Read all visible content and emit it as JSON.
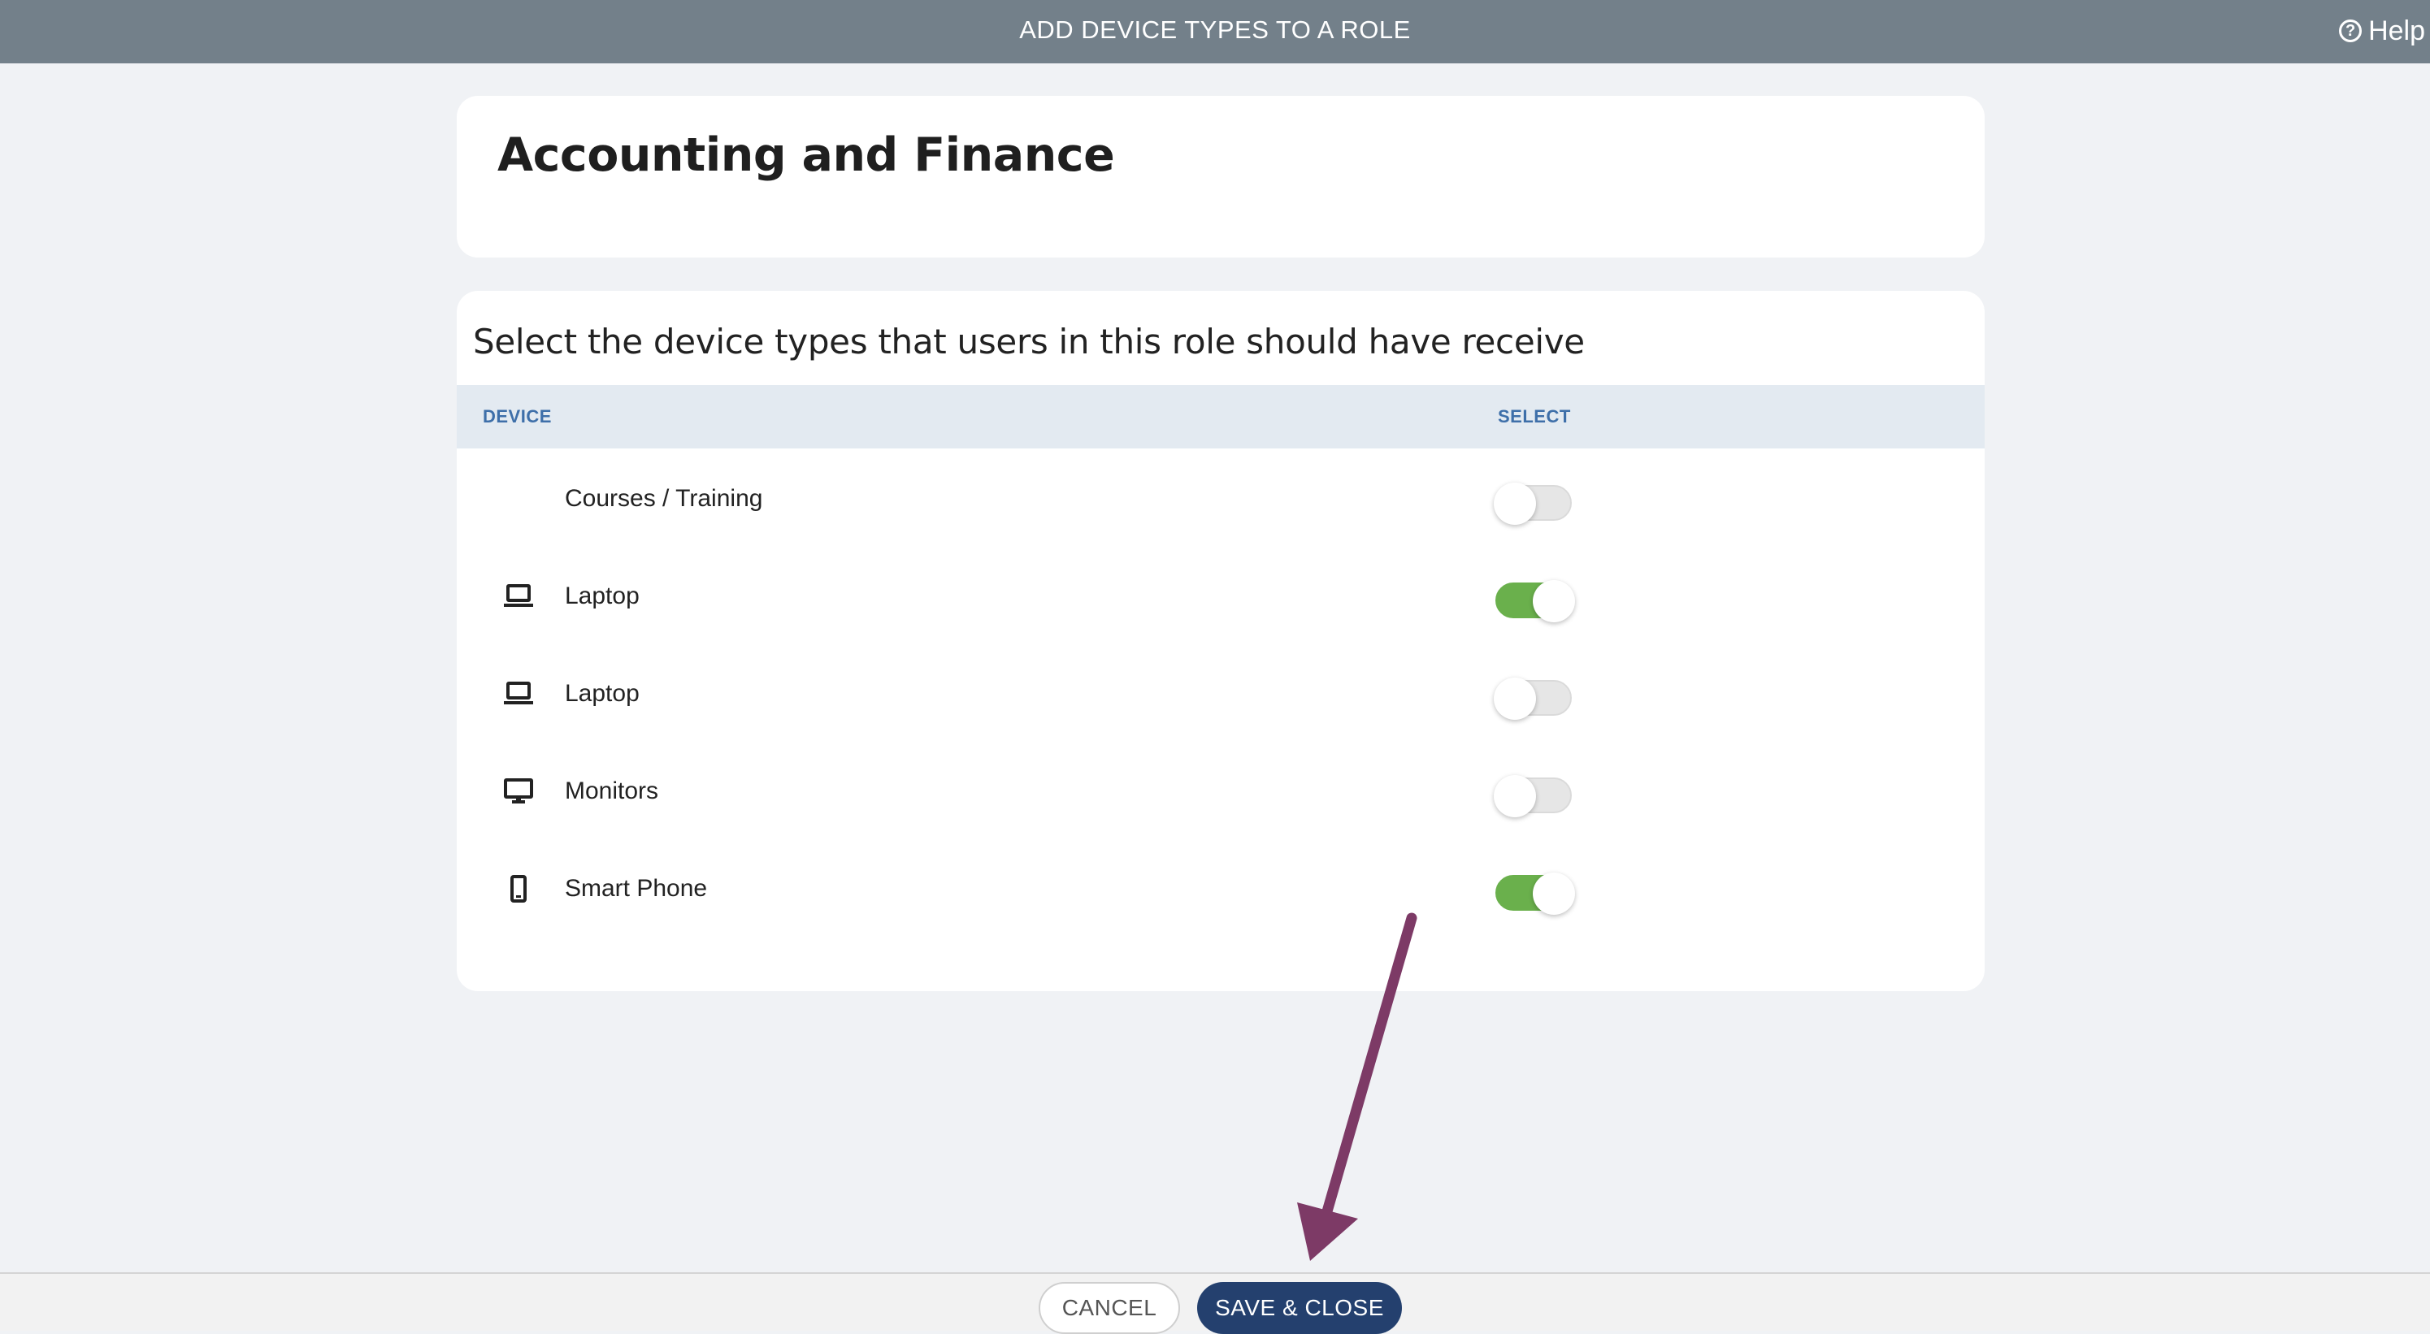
{
  "header": {
    "title": "ADD DEVICE TYPES TO A ROLE",
    "help_label": "Help",
    "help_icon_glyph": "?"
  },
  "role": {
    "name": "Accounting and Finance"
  },
  "devices": {
    "instruction": "Select the device types that users in this role should have receive",
    "columns": {
      "device": "DEVICE",
      "select": "SELECT"
    },
    "rows": [
      {
        "label": "Courses / Training",
        "icon": "none",
        "selected": false
      },
      {
        "label": "Laptop",
        "icon": "laptop-icon",
        "selected": true
      },
      {
        "label": "Laptop",
        "icon": "laptop-icon",
        "selected": false
      },
      {
        "label": "Monitors",
        "icon": "monitor-icon",
        "selected": false
      },
      {
        "label": "Smart Phone",
        "icon": "smartphone-icon",
        "selected": true
      }
    ]
  },
  "footer": {
    "cancel_label": "CANCEL",
    "save_label": "SAVE & CLOSE"
  },
  "colors": {
    "header_bg": "#73808a",
    "page_bg": "#f0f2f5",
    "table_header_bg": "#e3eaf1",
    "column_header_text": "#3e6fa9",
    "toggle_on": "#6ab04c",
    "toggle_off": "#e6e6e6",
    "save_button_bg": "#24406e",
    "annotation_arrow": "#7d3a66"
  }
}
